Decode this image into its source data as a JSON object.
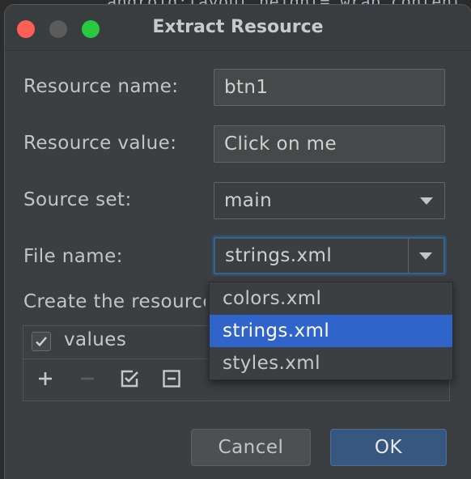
{
  "background_code": {
    "text": "android:layout_height=\"wrap_content\""
  },
  "dialog": {
    "title": "Extract Resource",
    "resource_name_label": "Resource name:",
    "resource_name_value": "btn1",
    "resource_value_label": "Resource value:",
    "resource_value_value": "Click on me",
    "source_set_label": "Source set:",
    "source_set_value": "main",
    "file_name_label": "File name:",
    "file_name_value": "strings.xml",
    "create_label": "Create the resource in directories:",
    "directories": [
      {
        "label": "values",
        "checked": true
      }
    ],
    "cancel_label": "Cancel",
    "ok_label": "OK"
  },
  "file_name_dropdown": {
    "options": [
      "colors.xml",
      "strings.xml",
      "styles.xml"
    ],
    "selected": "strings.xml"
  },
  "colors": {
    "selection": "#2f65ca",
    "default_button": "#365880",
    "close": "#fe5f57",
    "maximize": "#28c840"
  }
}
